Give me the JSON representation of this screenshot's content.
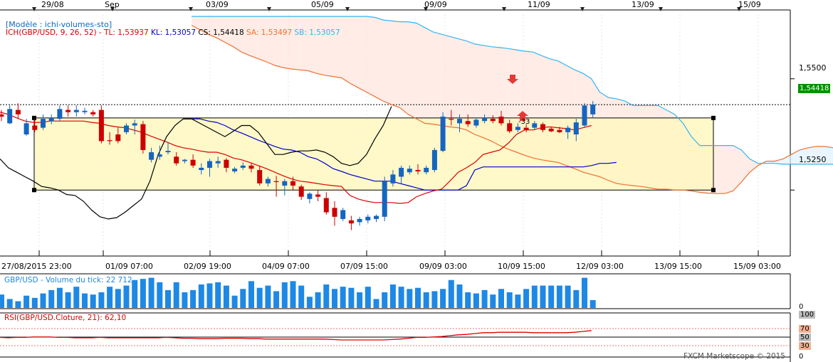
{
  "top_dates": [
    "29/08",
    "Sep",
    "03/09",
    "05/09",
    "09/09",
    "11/09",
    "13/09",
    "15/09"
  ],
  "bottom_dates": [
    "27/08/2015 23:00",
    "01/09 07:00",
    "02/09 19:00",
    "04/09 07:00",
    "07/09 15:00",
    "09/09 03:00",
    "10/09 15:00",
    "12/09 03:00",
    "13/09 15:00",
    "15/09 03:00"
  ],
  "model_label": "[Modèle : ichi-volumes-sto]",
  "ichimoku_legend": {
    "name": "ICH(GBP/USD, 9, 26, 52) -",
    "tl": "TL: 1,53937",
    "kl": "KL: 1,53057",
    "cs": "CS: 1,54418",
    "sa": "SA: 1,53497",
    "sb": "SB: 1,53057"
  },
  "price_axis": [
    "1,5500",
    "1,5250"
  ],
  "last_price": "1,54418",
  "signal_value": "-33",
  "volume_legend": "GBP/USD - Volume du tick: 22 712",
  "volume_axis_zero": "0",
  "rsi_legend": "RSI(GBP/USD.Cloture, 21): 62,10",
  "rsi_axis": [
    "100",
    "70",
    "50",
    "30",
    "0"
  ],
  "copyright": "FXCM Marketscope © 2015",
  "colors": {
    "tenkan": "#dd0000",
    "kijun": "#0000cc",
    "chikou": "#000000",
    "senkou_a": "#f07030",
    "senkou_b": "#33b5f0",
    "bull": "#1565c0",
    "bear": "#cc0000",
    "volume": "#1e88e5",
    "rsi": "#dd0000",
    "rectangle_fill": "#fff7c0"
  },
  "chart_data": {
    "type": "candlestick",
    "price_range": [
      1.5105,
      1.5645
    ],
    "rectangle_levels": [
      1.5412,
      1.525
    ],
    "horizontal_line": 1.5442,
    "candles": [
      [
        1.542,
        1.543,
        1.5405,
        1.5415
      ],
      [
        1.54,
        1.544,
        1.5398,
        1.5432
      ],
      [
        1.543,
        1.5445,
        1.541,
        1.542
      ],
      [
        1.5375,
        1.541,
        1.5372,
        1.54
      ],
      [
        1.5395,
        1.541,
        1.538,
        1.5385
      ],
      [
        1.539,
        1.542,
        1.5385,
        1.541
      ],
      [
        1.5405,
        1.542,
        1.5398,
        1.5412
      ],
      [
        1.541,
        1.544,
        1.5405,
        1.5432
      ],
      [
        1.543,
        1.544,
        1.5415,
        1.5425
      ],
      [
        1.5425,
        1.544,
        1.5415,
        1.543
      ],
      [
        1.5425,
        1.5435,
        1.542,
        1.5428
      ],
      [
        1.5425,
        1.543,
        1.5415,
        1.542
      ],
      [
        1.543,
        1.544,
        1.5355,
        1.536
      ],
      [
        1.5362,
        1.538,
        1.5352,
        1.536
      ],
      [
        1.5375,
        1.539,
        1.5355,
        1.536
      ],
      [
        1.538,
        1.54,
        1.5375,
        1.5395
      ],
      [
        1.5395,
        1.5408,
        1.5375,
        1.54
      ],
      [
        1.5398,
        1.5405,
        1.5332,
        1.534
      ],
      [
        1.5318,
        1.5345,
        1.5312,
        1.5335
      ],
      [
        1.5325,
        1.535,
        1.5318,
        1.533
      ],
      [
        1.5335,
        1.5358,
        1.533,
        1.5338
      ],
      [
        1.5325,
        1.5335,
        1.5305,
        1.531
      ],
      [
        1.5315,
        1.532,
        1.531,
        1.5318
      ],
      [
        1.5318,
        1.533,
        1.53,
        1.5305
      ],
      [
        1.5295,
        1.531,
        1.5285,
        1.53
      ],
      [
        1.53,
        1.532,
        1.528,
        1.5315
      ],
      [
        1.531,
        1.5325,
        1.53,
        1.5315
      ],
      [
        1.5318,
        1.5322,
        1.529,
        1.53
      ],
      [
        1.5292,
        1.5302,
        1.5288,
        1.5298
      ],
      [
        1.53,
        1.5312,
        1.5295,
        1.5305
      ],
      [
        1.5305,
        1.531,
        1.529,
        1.5298
      ],
      [
        1.5295,
        1.5305,
        1.526,
        1.5265
      ],
      [
        1.5265,
        1.528,
        1.5258,
        1.5275
      ],
      [
        1.527,
        1.5282,
        1.5235,
        1.5268
      ],
      [
        1.526,
        1.5275,
        1.5238,
        1.527
      ],
      [
        1.527,
        1.528,
        1.525,
        1.526
      ],
      [
        1.5258,
        1.5262,
        1.5228,
        1.5235
      ],
      [
        1.523,
        1.5245,
        1.522,
        1.5242
      ],
      [
        1.524,
        1.525,
        1.5225,
        1.5235
      ],
      [
        1.5232,
        1.5245,
        1.5195,
        1.52
      ],
      [
        1.521,
        1.5225,
        1.517,
        1.519
      ],
      [
        1.5185,
        1.521,
        1.518,
        1.5205
      ],
      [
        1.5182,
        1.5192,
        1.516,
        1.5175
      ],
      [
        1.5178,
        1.519,
        1.517,
        1.5185
      ],
      [
        1.5182,
        1.5195,
        1.5175,
        1.519
      ],
      [
        1.5185,
        1.5195,
        1.5178,
        1.5192
      ],
      [
        1.519,
        1.528,
        1.518,
        1.527
      ],
      [
        1.5265,
        1.5295,
        1.5258,
        1.5285
      ],
      [
        1.528,
        1.5305,
        1.5265,
        1.53
      ],
      [
        1.529,
        1.5305,
        1.5285,
        1.5298
      ],
      [
        1.5295,
        1.5308,
        1.5285,
        1.5292
      ],
      [
        1.529,
        1.5305,
        1.5285,
        1.53
      ],
      [
        1.5295,
        1.5345,
        1.529,
        1.534
      ],
      [
        1.5338,
        1.5425,
        1.5335,
        1.5415
      ],
      [
        1.541,
        1.543,
        1.5395,
        1.5408
      ],
      [
        1.54,
        1.542,
        1.538,
        1.541
      ],
      [
        1.5405,
        1.542,
        1.5392,
        1.5398
      ],
      [
        1.5395,
        1.5412,
        1.539,
        1.5408
      ],
      [
        1.5405,
        1.542,
        1.54,
        1.5412
      ],
      [
        1.541,
        1.5418,
        1.54,
        1.5405
      ],
      [
        1.5415,
        1.5428,
        1.5395,
        1.54
      ],
      [
        1.54,
        1.5408,
        1.5378,
        1.5382
      ],
      [
        1.5385,
        1.54,
        1.538,
        1.5392
      ],
      [
        1.539,
        1.5398,
        1.538,
        1.5385
      ],
      [
        1.539,
        1.5405,
        1.5385,
        1.54
      ],
      [
        1.5398,
        1.5402,
        1.538,
        1.5385
      ],
      [
        1.5388,
        1.5392,
        1.538,
        1.5382
      ],
      [
        1.5385,
        1.5392,
        1.5378,
        1.538
      ],
      [
        1.538,
        1.5395,
        1.5365,
        1.539
      ],
      [
        1.5375,
        1.541,
        1.536,
        1.5402
      ],
      [
        1.5395,
        1.5445,
        1.539,
        1.544
      ],
      [
        1.542,
        1.545,
        1.5412,
        1.5442
      ]
    ],
    "tenkan": [
      1.5425,
      1.542,
      1.5412,
      1.5405,
      1.5402,
      1.5402,
      1.5405,
      1.5405,
      1.5405,
      1.5405,
      1.5405,
      1.5402,
      1.54,
      1.5395,
      1.5392,
      1.539,
      1.5385,
      1.538,
      1.5372,
      1.5365,
      1.5358,
      1.535,
      1.5345,
      1.5342,
      1.5338,
      1.5335,
      1.5335,
      1.533,
      1.5322,
      1.5318,
      1.5312,
      1.5305,
      1.5298,
      1.529,
      1.5282,
      1.5275,
      1.527,
      1.5268,
      1.5265,
      1.5262,
      1.526,
      1.5258,
      1.5238,
      1.523,
      1.5225,
      1.5222,
      1.5222,
      1.5222,
      1.522,
      1.5222,
      1.5235,
      1.5242,
      1.5248,
      1.5252,
      1.527,
      1.529,
      1.53,
      1.5312,
      1.533,
      1.5335,
      1.534,
      1.5355,
      1.5375,
      1.5385,
      1.5385,
      1.539,
      1.5392,
      1.539,
      1.5388,
      1.5385,
      1.539,
      1.5395
    ],
    "kijun": [
      null,
      null,
      null,
      null,
      null,
      null,
      null,
      null,
      null,
      null,
      null,
      null,
      null,
      null,
      null,
      null,
      null,
      null,
      null,
      null,
      null,
      null,
      1.541,
      1.541,
      1.541,
      1.5405,
      1.5402,
      1.5395,
      1.5385,
      1.5378,
      1.537,
      1.5362,
      1.5355,
      1.5348,
      1.5342,
      1.534,
      1.5335,
      1.5325,
      1.532,
      1.531,
      1.5298,
      1.5292,
      1.5285,
      1.528,
      1.5275,
      1.527,
      1.527,
      1.527,
      1.5265,
      1.526,
      1.5255,
      1.525,
      1.525,
      1.525,
      1.525,
      1.525,
      1.526,
      1.5295,
      1.5302,
      1.5302,
      1.5302,
      1.5302,
      1.5302,
      1.5302,
      1.5302,
      1.5302,
      1.5302,
      1.5302,
      1.5302,
      1.5302,
      1.5302,
      1.5305,
      1.531,
      1.531,
      1.5312
    ],
    "chikou": [
      1.532,
      1.53,
      1.529,
      1.528,
      1.527,
      1.5258,
      1.5255,
      1.525,
      1.524,
      1.5238,
      1.5225,
      1.5205,
      1.519,
      1.5185,
      1.5188,
      1.52,
      1.5215,
      1.523,
      1.527,
      1.533,
      1.537,
      1.5395,
      1.541,
      1.541,
      1.54,
      1.539,
      1.538,
      1.537,
      1.5382,
      1.5395,
      1.5395,
      1.538,
      1.5355,
      1.533,
      1.533,
      1.5335,
      1.5338,
      1.5338,
      1.534,
      1.5335,
      1.5325,
      1.531,
      1.5305,
      1.531,
      1.533,
      1.5365,
      1.5395,
      1.5438
    ],
    "senkou_a": [
      null,
      null,
      null,
      null,
      null,
      null,
      null,
      null,
      null,
      null,
      null,
      null,
      null,
      null,
      null,
      null,
      null,
      null,
      null,
      null,
      null,
      null,
      null,
      1.562,
      1.561,
      1.56,
      1.5592,
      1.5582,
      1.5572,
      1.556,
      1.5552,
      1.5545,
      1.5538,
      1.553,
      1.5525,
      1.5522,
      1.552,
      1.5518,
      1.5512,
      1.5508,
      1.5505,
      1.5502,
      1.549,
      1.548,
      1.547,
      1.546,
      1.545,
      1.5442,
      1.5435,
      1.542,
      1.541,
      1.54,
      1.5398,
      1.5395,
      1.5392,
      1.539,
      1.5385,
      1.5375,
      1.5368,
      1.536,
      1.535,
      1.5342,
      1.5335,
      1.5328,
      1.5322,
      1.5318,
      1.5315,
      1.5312,
      1.5305,
      1.5298,
      1.529,
      1.5285,
      1.528,
      1.5272,
      1.5265,
      1.5262,
      1.526,
      1.5258,
      1.5255,
      1.5252,
      1.5252,
      1.525,
      1.525,
      1.5248,
      1.5245,
      1.5243,
      1.5242,
      1.5242,
      1.5248,
      1.5268,
      1.529,
      1.5305,
      1.5315,
      1.5315,
      1.532,
      1.533,
      1.534,
      1.5345,
      1.5348,
      1.5348,
      1.5345,
      1.5345,
      1.5355,
      1.5365
    ],
    "senkou_b": [
      null,
      null,
      null,
      null,
      null,
      null,
      null,
      null,
      null,
      null,
      null,
      null,
      null,
      null,
      null,
      null,
      null,
      null,
      null,
      null,
      null,
      null,
      null,
      1.564,
      1.564,
      1.564,
      1.564,
      1.564,
      1.564,
      1.564,
      1.564,
      1.564,
      1.564,
      1.564,
      1.564,
      1.564,
      1.564,
      1.564,
      1.564,
      1.564,
      1.564,
      1.564,
      1.564,
      1.564,
      1.564,
      1.5638,
      1.5632,
      1.563,
      1.5628,
      1.5628,
      1.5625,
      1.5615,
      1.5605,
      1.56,
      1.5595,
      1.559,
      1.5585,
      1.5578,
      1.5575,
      1.5572,
      1.557,
      1.5568,
      1.5565,
      1.5562,
      1.556,
      1.5552,
      1.5545,
      1.554,
      1.553,
      1.552,
      1.5512,
      1.55,
      1.547,
      1.5458,
      1.5455,
      1.545,
      1.544,
      1.544,
      1.544,
      1.544,
      1.543,
      1.542,
      1.54,
      1.537,
      1.535,
      1.535,
      1.535,
      1.535,
      1.535,
      1.534,
      1.532,
      1.531,
      1.531,
      1.531,
      1.5308,
      1.5308,
      1.5308,
      1.5308,
      1.5308,
      1.5308,
      1.5308,
      1.531,
      1.5315,
      1.5315
    ],
    "volume": [
      12,
      8,
      6,
      11,
      9,
      13,
      16,
      18,
      14,
      19,
      13,
      12,
      14,
      19,
      17,
      20,
      25,
      26,
      27,
      23,
      16,
      23,
      14,
      16,
      21,
      22,
      23,
      20,
      11,
      17,
      24,
      18,
      20,
      15,
      23,
      24,
      20,
      10,
      14,
      21,
      17,
      19,
      18,
      14,
      19,
      8,
      14,
      21,
      19,
      17,
      18,
      14,
      15,
      17,
      25,
      21,
      14,
      13,
      16,
      12,
      17,
      14,
      12,
      17,
      20,
      20,
      20,
      20,
      20,
      16,
      27,
      7
    ],
    "rsi": [
      46,
      45,
      46,
      46,
      47,
      47,
      47,
      46,
      46,
      45,
      45,
      45,
      46,
      45,
      45,
      45,
      45,
      45,
      45,
      45,
      46,
      45,
      44,
      44,
      43,
      43,
      43,
      44,
      44,
      44,
      43,
      43,
      42,
      42,
      42,
      42,
      42,
      42,
      42,
      42,
      41,
      40,
      40,
      40,
      40,
      40,
      40,
      41,
      42,
      44,
      46,
      46,
      47,
      48,
      50,
      52,
      53,
      55,
      57,
      57,
      58,
      58,
      58,
      58,
      57,
      57,
      57,
      57,
      57,
      58,
      60,
      62
    ]
  }
}
